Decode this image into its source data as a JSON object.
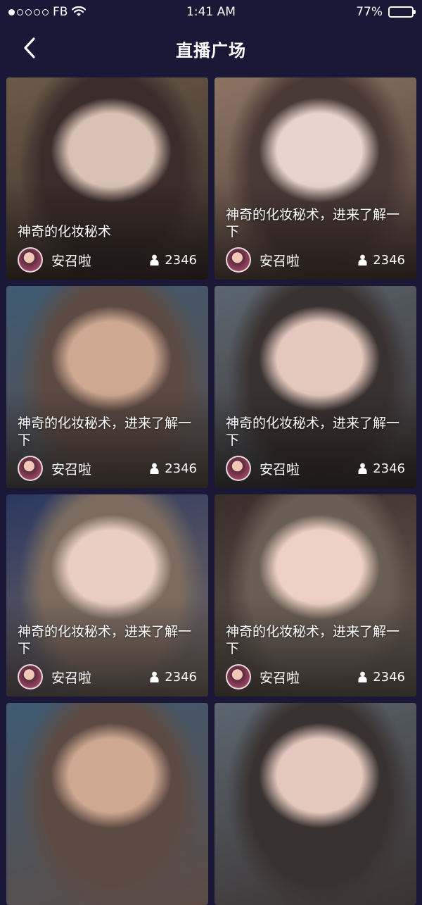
{
  "status_bar": {
    "carrier": "FB",
    "time": "1:41 AM",
    "battery": "77%",
    "battery_level": 0.77
  },
  "header": {
    "title": "直播广场"
  },
  "cards": [
    {
      "caption": "神奇的化妆秘术",
      "user": "安召啦",
      "viewers": "2346",
      "palette": [
        "#3a2d2a",
        "#d9c2b5",
        "#6a5a48"
      ]
    },
    {
      "caption": "神奇的化妆秘术，进来了解一下",
      "user": "安召啦",
      "viewers": "2346",
      "palette": [
        "#4a3a36",
        "#e6d5cc",
        "#8c7462"
      ]
    },
    {
      "caption": "神奇的化妆秘术，进来了解一下",
      "user": "安召啦",
      "viewers": "2346",
      "palette": [
        "#5c4b43",
        "#cfa892",
        "#3f5b73"
      ]
    },
    {
      "caption": "神奇的化妆秘术，进来了解一下",
      "user": "安召啦",
      "viewers": "2346",
      "palette": [
        "#3a3230",
        "#e3c8bd",
        "#5b6670"
      ]
    },
    {
      "caption": "神奇的化妆秘术，进来了解一下",
      "user": "安召啦",
      "viewers": "2346",
      "palette": [
        "#7c6c60",
        "#e9cfc2",
        "#2a3860"
      ]
    },
    {
      "caption": "神奇的化妆秘术，进来了解一下",
      "user": "安召啦",
      "viewers": "2346",
      "palette": [
        "#6a5f55",
        "#edd2c4",
        "#3a2e2a"
      ]
    },
    {
      "caption": "",
      "user": "",
      "viewers": "",
      "palette": [
        "#5c4b43",
        "#cfa892",
        "#3f5b73"
      ]
    },
    {
      "caption": "",
      "user": "",
      "viewers": "",
      "palette": [
        "#3a3230",
        "#e3c8bd",
        "#5b6670"
      ]
    }
  ]
}
